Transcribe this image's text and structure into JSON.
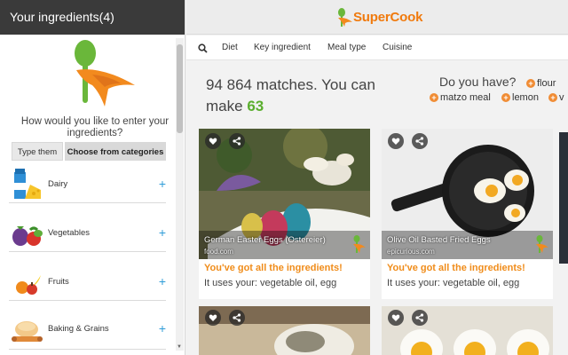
{
  "sidebar": {
    "title": "Your ingredients(4)",
    "prompt": "How would you like to enter your ingredients?",
    "mode_buttons": [
      "Type them",
      "Choose from categories"
    ],
    "categories": [
      {
        "label": "Dairy",
        "plus": "+"
      },
      {
        "label": "Vegetables",
        "plus": "+"
      },
      {
        "label": "Fruits",
        "plus": "+"
      },
      {
        "label": "Baking & Grains",
        "plus": "+"
      }
    ]
  },
  "brand": {
    "name": "SuperCook",
    "accent": "#f07a0d",
    "green": "#5aae2e"
  },
  "filters": {
    "search_icon": "search-icon",
    "items": [
      "Diet",
      "Key ingredient",
      "Meal type",
      "Cuisine"
    ]
  },
  "results": {
    "matches_text": "94 864 matches. You can make",
    "can_make": "63"
  },
  "suggest": {
    "question": "Do you have?",
    "chips": [
      "flour",
      "matzo meal",
      "lemon",
      "v"
    ]
  },
  "recipes": [
    {
      "title": "German Easter Eggs (Ostereier)",
      "source": "food.com",
      "status": "You've got all the ingredients!",
      "uses": "It uses your: vegetable oil, egg"
    },
    {
      "title": "Olive Oil Basted Fried Eggs",
      "source": "epicurious.com",
      "status": "You've got all the ingredients!",
      "uses": "It uses your: vegetable oil, egg"
    }
  ]
}
